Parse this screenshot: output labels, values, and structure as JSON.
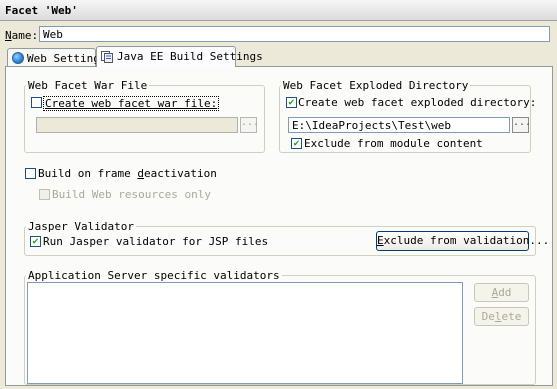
{
  "window": {
    "title": "Facet 'Web'"
  },
  "name_field": {
    "label_u": "N",
    "label_rest": "ame:",
    "value": "Web"
  },
  "tabs": [
    {
      "label": "Web Settings",
      "icon": "web-globe-icon"
    },
    {
      "label": "Java EE Build Settings",
      "icon": "java-ee-icon"
    }
  ],
  "war_group": {
    "title": "Web Facet War File",
    "create_checkbox_label": "Create web facet war file:",
    "create_checked": false,
    "path_value": "",
    "browse_label": "..."
  },
  "exploded_group": {
    "title": "Web Facet Exploded Directory",
    "create_checkbox_label": "Create web facet exploded directory:",
    "create_checked": true,
    "path_value": "E:\\IdeaProjects\\Test\\web",
    "browse_label": "...",
    "exclude_label": "Exclude from module content",
    "exclude_checked": true
  },
  "build_on_frame": {
    "label_before": "Build on frame ",
    "label_u": "d",
    "label_after": "eactivation",
    "checked": false
  },
  "build_web_resources": {
    "label": "Build Web resources only",
    "checked": false
  },
  "jasper_group": {
    "title": "Jasper Validator",
    "run_label": "Run Jasper validator for JSP files",
    "run_checked": true,
    "exclude_button_u": "E",
    "exclude_button_rest": "xclude from validation..."
  },
  "app_server_group": {
    "title": "Application Server specific validators",
    "add_u": "A",
    "add_rest": "dd",
    "delete_before": "De",
    "delete_u": "l",
    "delete_after": "ete"
  }
}
